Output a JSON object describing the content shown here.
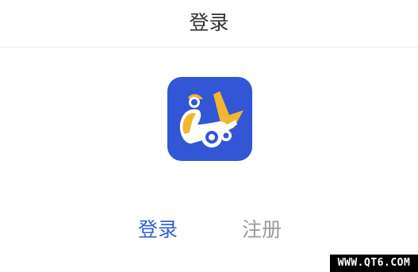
{
  "header": {
    "title": "登录"
  },
  "app_logo": {
    "icon": "scooter-rider-icon",
    "colors": {
      "background": "#3256d6",
      "accent": "#f3b62f",
      "figure": "#ffffff"
    }
  },
  "tabs": [
    {
      "label": "登录",
      "active": true,
      "color": "#3462d8"
    },
    {
      "label": "注册",
      "active": false,
      "color": "#9b9b9b"
    }
  ],
  "watermark": {
    "text": "WWW.QT6.COM"
  }
}
